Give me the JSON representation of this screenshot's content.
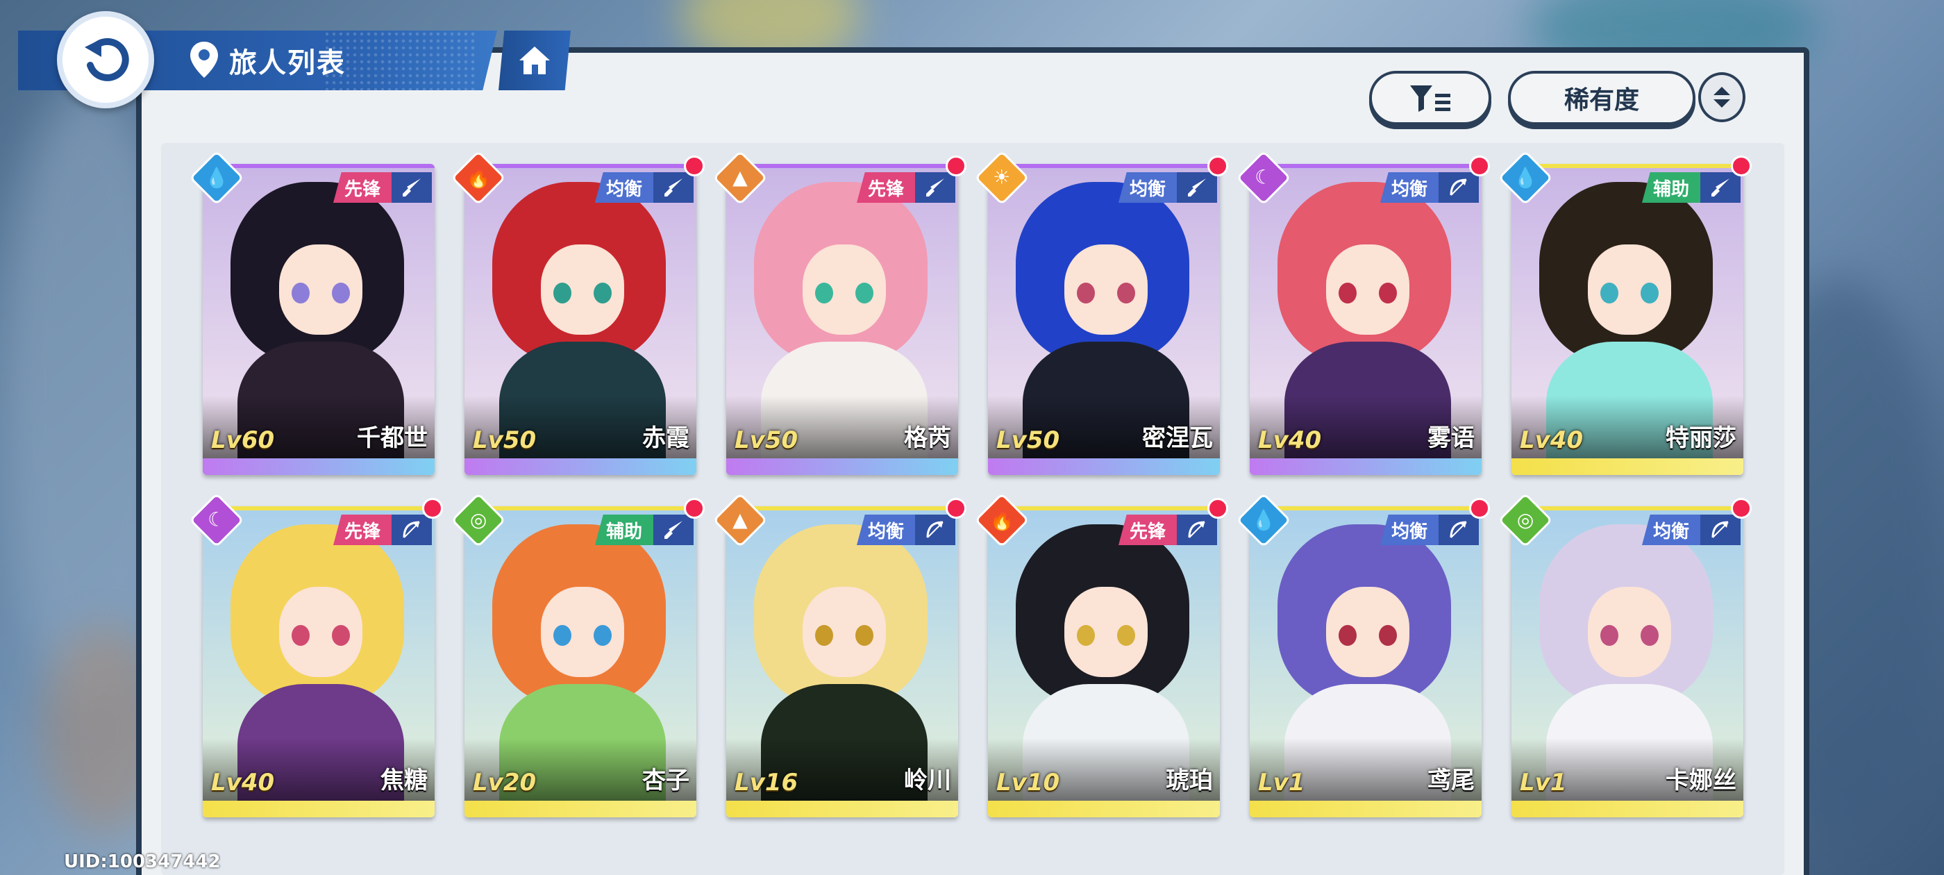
{
  "header": {
    "title": "旅人列表",
    "back_icon": "back-arrow-icon",
    "home_icon": "home-icon",
    "location_icon": "location-pin-icon"
  },
  "toolbar": {
    "filter_icon": "filter-icon",
    "sort_label": "稀有度",
    "order_icon": "sort-order-icon"
  },
  "roles_colors": {
    "先锋": "#e0457b",
    "均衡": "#4c6fd0",
    "辅助": "#2fae6c"
  },
  "cards": [
    {
      "level": "Lv60",
      "name": "千都世",
      "role": "先锋",
      "element": "water",
      "weapon": "sword",
      "new": false,
      "rarity_color": "#b46df0",
      "bar": "linear-gradient(90deg,#c07af0,#7fd0f2)",
      "hair": "#1b1726",
      "eye": "#8c7dd8",
      "cloth": "#2a2030"
    },
    {
      "level": "Lv50",
      "name": "赤霞",
      "role": "均衡",
      "element": "fire",
      "weapon": "sword",
      "new": true,
      "rarity_color": "#b46df0",
      "bar": "linear-gradient(90deg,#c07af0,#7fd0f2)",
      "hair": "#c8262e",
      "eye": "#2f9e8e",
      "cloth": "#1f3b44"
    },
    {
      "level": "Lv50",
      "name": "格芮",
      "role": "先锋",
      "element": "earth",
      "weapon": "sword",
      "new": true,
      "rarity_color": "#b46df0",
      "bar": "linear-gradient(90deg,#c07af0,#7fd0f2)",
      "hair": "#f29bb4",
      "eye": "#3ab79a",
      "cloth": "#f4f0ee"
    },
    {
      "level": "Lv50",
      "name": "密涅瓦",
      "role": "均衡",
      "element": "light",
      "weapon": "sword",
      "new": true,
      "rarity_color": "#b46df0",
      "bar": "linear-gradient(90deg,#c07af0,#7fd0f2)",
      "hair": "#2142c8",
      "eye": "#c04a6a",
      "cloth": "#1c1f2e"
    },
    {
      "level": "Lv40",
      "name": "雾语",
      "role": "均衡",
      "element": "dark",
      "weapon": "bow",
      "new": true,
      "rarity_color": "#b46df0",
      "bar": "linear-gradient(90deg,#c07af0,#7fd0f2)",
      "hair": "#e55a6c",
      "eye": "#c0304a",
      "cloth": "#4a2c6a"
    },
    {
      "level": "Lv40",
      "name": "特丽莎",
      "role": "辅助",
      "element": "water",
      "weapon": "sword",
      "new": true,
      "rarity_color": "#f2e24a",
      "bar": "linear-gradient(90deg,#f4e04a,#f8ef8a)",
      "hair": "#2a2218",
      "eye": "#3fb0c0",
      "cloth": "#8ee8e0"
    },
    {
      "level": "Lv40",
      "name": "焦糖",
      "role": "先锋",
      "element": "dark",
      "weapon": "bow",
      "new": true,
      "rarity_color": "#f2e24a",
      "bar": "linear-gradient(90deg,#f4e04a,#f8ef8a)",
      "hair": "#f4d35a",
      "eye": "#d04a70",
      "cloth": "#6e3a8a"
    },
    {
      "level": "Lv20",
      "name": "杏子",
      "role": "辅助",
      "element": "wind",
      "weapon": "sword",
      "new": true,
      "rarity_color": "#f2e24a",
      "bar": "linear-gradient(90deg,#f4e04a,#f8ef8a)",
      "hair": "#ee7a38",
      "eye": "#3a9ad8",
      "cloth": "#8bcf6a"
    },
    {
      "level": "Lv16",
      "name": "岭川",
      "role": "均衡",
      "element": "earth",
      "weapon": "bow",
      "new": true,
      "rarity_color": "#f2e24a",
      "bar": "linear-gradient(90deg,#f4e04a,#f8ef8a)",
      "hair": "#f2dc8a",
      "eye": "#c89a2a",
      "cloth": "#1e2a1e"
    },
    {
      "level": "Lv10",
      "name": "琥珀",
      "role": "先锋",
      "element": "fire",
      "weapon": "bow",
      "new": true,
      "rarity_color": "#f2e24a",
      "bar": "linear-gradient(90deg,#f4e04a,#f8ef8a)",
      "hair": "#1c1c24",
      "eye": "#d6b03a",
      "cloth": "#eef2f4"
    },
    {
      "level": "Lv1",
      "name": "鸢尾",
      "role": "均衡",
      "element": "water",
      "weapon": "bow",
      "new": true,
      "rarity_color": "#f2e24a",
      "bar": "linear-gradient(90deg,#f4e04a,#f8ef8a)",
      "hair": "#6a5ec4",
      "eye": "#b03048",
      "cloth": "#f2f2f6"
    },
    {
      "level": "Lv1",
      "name": "卡娜丝",
      "role": "均衡",
      "element": "wind",
      "weapon": "bow",
      "new": true,
      "rarity_color": "#f2e24a",
      "bar": "linear-gradient(90deg,#f4e04a,#f8ef8a)",
      "hair": "#d8cde8",
      "eye": "#c05080",
      "cloth": "#f4f4f8"
    }
  ],
  "element_colors": {
    "water": "#2e9be0",
    "fire": "#ee4a2a",
    "earth": "#e88a3a",
    "light": "#f4a630",
    "dark": "#b14fd6",
    "wind": "#5cb83a"
  },
  "element_glyphs": {
    "water": "💧",
    "fire": "🔥",
    "earth": "▲",
    "light": "☀",
    "dark": "☾",
    "wind": "◎"
  },
  "uid": "UID:100347442"
}
